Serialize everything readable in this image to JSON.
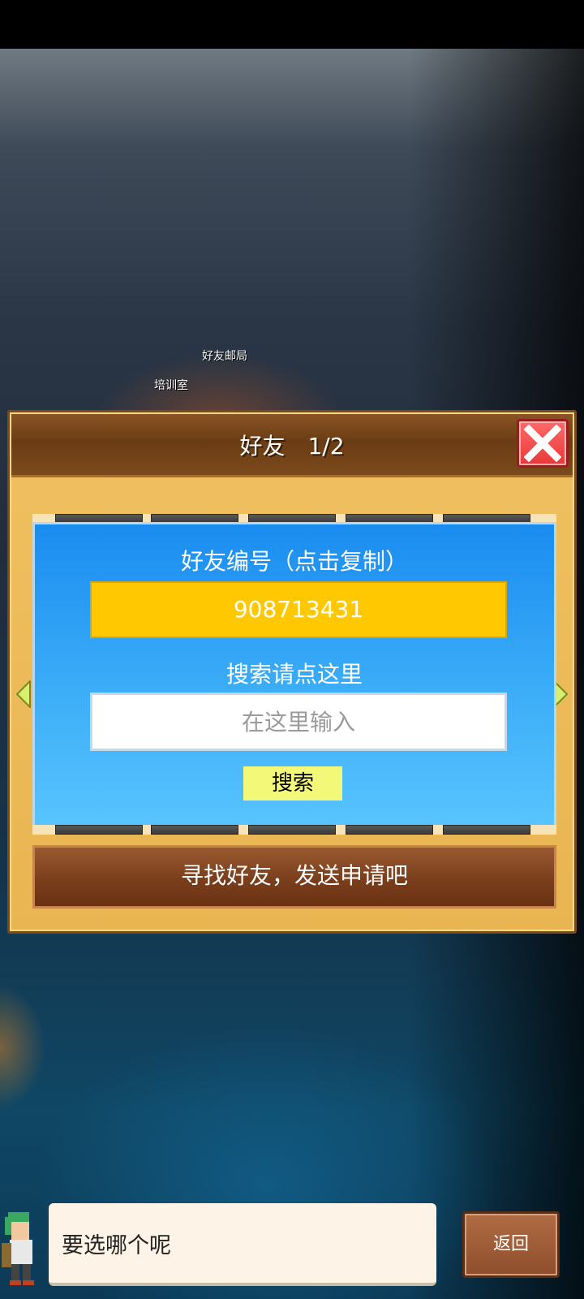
{
  "background": {
    "labels": [
      "好友邮局",
      "培训室"
    ]
  },
  "dialog": {
    "title": "好友　1/2"
  },
  "friend_panel": {
    "friend_id_label": "好友编号（点击复制）",
    "friend_id_value": "908713431",
    "search_label": "搜索请点这里",
    "search_placeholder": "在这里输入",
    "search_value": "",
    "search_button_label": "搜索"
  },
  "find_friends_banner": "寻找好友，发送申请吧",
  "bottom_bar": {
    "message": "要选哪个呢",
    "back_label": "返回"
  },
  "colors": {
    "panel_blue": "#1a8cf0",
    "id_box_yellow": "#ffc800",
    "search_button": "#f4f878",
    "close_red": "#e83838"
  },
  "icons": [
    "close-icon",
    "arrow-left-icon",
    "arrow-right-icon",
    "character-avatar"
  ]
}
